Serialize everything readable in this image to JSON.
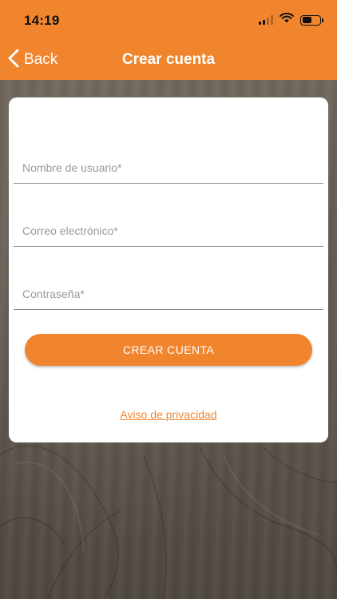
{
  "status_bar": {
    "time": "14:19",
    "icons": [
      "cellular-signal-icon",
      "wifi-icon",
      "battery-icon"
    ],
    "battery_level": 0.55
  },
  "nav": {
    "back_label": "Back",
    "title": "Crear cuenta"
  },
  "form": {
    "username_placeholder": "Nombre de usuario*",
    "email_placeholder": "Correo electrónico*",
    "password_placeholder": "Contraseña*",
    "submit_label": "CREAR CUENTA",
    "privacy_link": "Aviso de privacidad"
  },
  "colors": {
    "accent": "#f0852e",
    "card": "#ffffff",
    "background_wood": "#6e655a"
  }
}
